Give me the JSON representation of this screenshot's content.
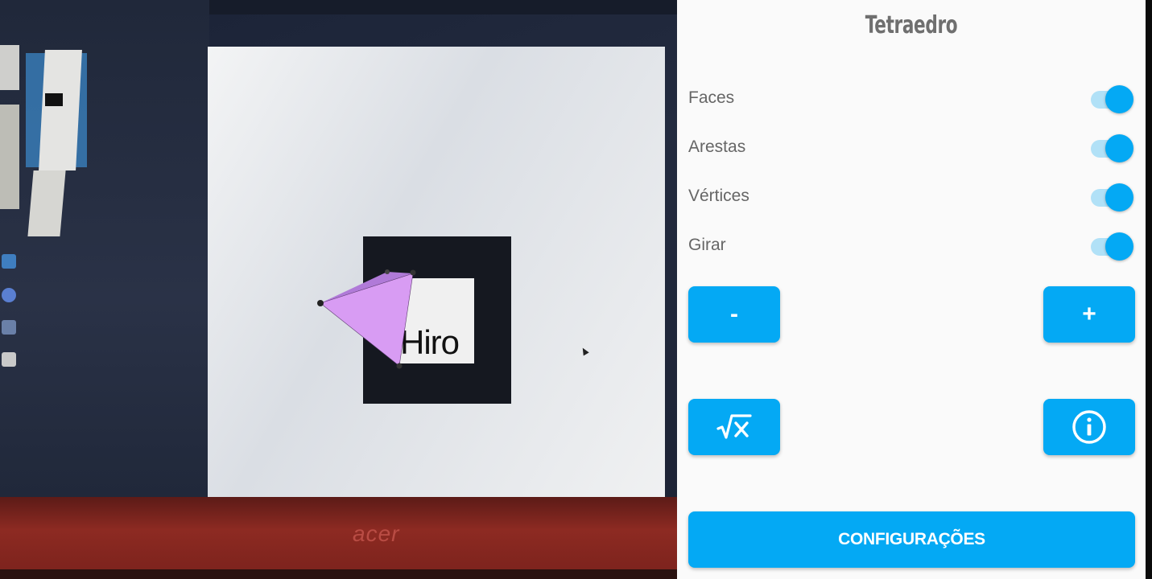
{
  "camera": {
    "marker_text": "Hiro",
    "laptop_brand": "acer",
    "shape_color": "#d89cf3",
    "shape_shade_color": "#b07ad8"
  },
  "panel": {
    "title": "Tetraedro",
    "toggles": [
      {
        "label": "Faces",
        "on": true
      },
      {
        "label": "Arestas",
        "on": true
      },
      {
        "label": "Vértices",
        "on": true
      },
      {
        "label": "Girar",
        "on": true
      }
    ],
    "buttons": {
      "decrease_label": "-",
      "increase_label": "+",
      "formula_icon": "square-root-x-icon",
      "info_icon": "info-circle-icon"
    },
    "settings_label": "CONFIGURAÇÕES",
    "accent_color": "#04a9f4"
  }
}
